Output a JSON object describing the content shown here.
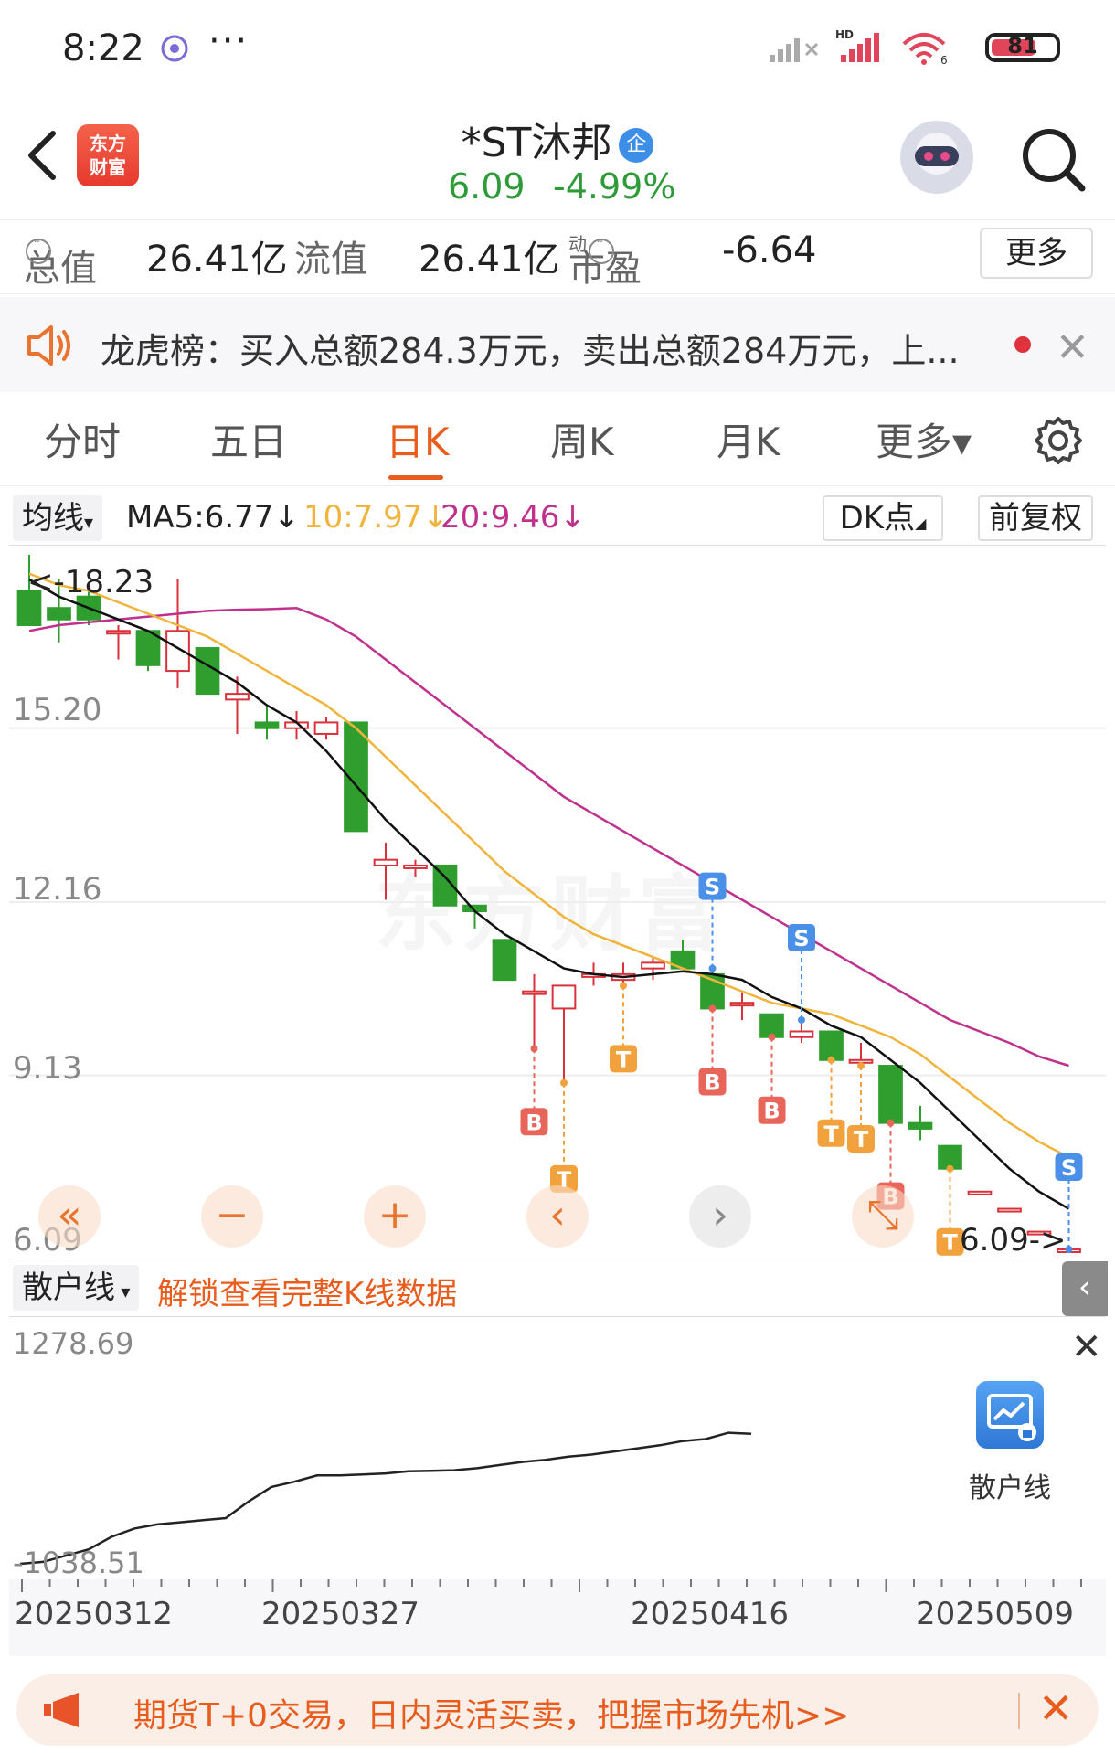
{
  "status_bar": {
    "time": "8:22",
    "dots": "···",
    "battery": "81"
  },
  "header": {
    "logo_line1": "东方",
    "logo_line2": "财富",
    "stock_name": "*ST沐邦",
    "stock_tag": "企",
    "price": "6.09",
    "change": "-4.99%"
  },
  "metrics": {
    "total_value_label": "总值",
    "total_value": "26.41亿",
    "float_value_label": "流值",
    "float_value": "26.41亿",
    "pe_label": "市盈",
    "pe_super": "动",
    "pe_value": "-6.64",
    "more_button": "更多"
  },
  "alert": {
    "text": "龙虎榜：买入总额284.3万元，卖出总额284万元，上..."
  },
  "tabs": [
    {
      "label": "分时"
    },
    {
      "label": "五日"
    },
    {
      "label": "日K"
    },
    {
      "label": "周K"
    },
    {
      "label": "月K"
    },
    {
      "label": "更多▾"
    }
  ],
  "active_tab": "日K",
  "ma_bar": {
    "selector": "均线",
    "ma5": "MA5:6.77",
    "ma10": "10:7.97",
    "ma20": "20:9.46",
    "dk_button": "DK点",
    "fq_button": "前复权"
  },
  "kchart": {
    "watermark": "东方财富",
    "y_labels": [
      "15.20",
      "12.16",
      "9.13",
      "6.09"
    ],
    "high_label": "<-18.23",
    "low_label": "6.09->",
    "colors": {
      "up": "#d8323c",
      "down": "#2f9e2f",
      "ma5": "#111111",
      "ma10": "#f0b33c",
      "ma20": "#c0318d"
    }
  },
  "chart_data": {
    "type": "candlestick",
    "price_range": [
      6.09,
      18.23
    ],
    "candles": [
      {
        "o": 17.6,
        "h": 18.23,
        "l": 17.0,
        "c": 17.0
      },
      {
        "o": 17.3,
        "h": 17.8,
        "l": 16.7,
        "c": 17.1
      },
      {
        "o": 17.5,
        "h": 17.7,
        "l": 17.0,
        "c": 17.1
      },
      {
        "o": 16.9,
        "h": 17.0,
        "l": 16.4,
        "c": 16.9
      },
      {
        "o": 16.9,
        "h": 16.9,
        "l": 16.2,
        "c": 16.3
      },
      {
        "o": 16.2,
        "h": 17.8,
        "l": 15.9,
        "c": 16.9
      },
      {
        "o": 16.6,
        "h": 16.6,
        "l": 15.8,
        "c": 15.8
      },
      {
        "o": 15.7,
        "h": 16.1,
        "l": 15.1,
        "c": 15.8
      },
      {
        "o": 15.3,
        "h": 15.6,
        "l": 15.0,
        "c": 15.2
      },
      {
        "o": 15.2,
        "h": 15.5,
        "l": 15.0,
        "c": 15.3
      },
      {
        "o": 15.1,
        "h": 15.4,
        "l": 15.0,
        "c": 15.3
      },
      {
        "o": 15.3,
        "h": 15.3,
        "l": 13.4,
        "c": 13.4
      },
      {
        "o": 12.8,
        "h": 13.2,
        "l": 12.2,
        "c": 12.9
      },
      {
        "o": 12.8,
        "h": 12.9,
        "l": 12.6,
        "c": 12.8
      },
      {
        "o": 12.8,
        "h": 12.8,
        "l": 12.1,
        "c": 12.1
      },
      {
        "o": 12.1,
        "h": 12.1,
        "l": 11.7,
        "c": 12.0
      },
      {
        "o": 11.5,
        "h": 11.5,
        "l": 10.8,
        "c": 10.8
      },
      {
        "o": 10.6,
        "h": 10.9,
        "l": 9.6,
        "c": 10.6
      },
      {
        "o": 10.3,
        "h": 10.7,
        "l": 9.0,
        "c": 10.7
      },
      {
        "o": 10.9,
        "h": 11.1,
        "l": 10.7,
        "c": 10.9
      },
      {
        "o": 10.8,
        "h": 11.1,
        "l": 10.7,
        "c": 10.9
      },
      {
        "o": 11.0,
        "h": 11.2,
        "l": 10.8,
        "c": 11.1
      },
      {
        "o": 11.3,
        "h": 11.5,
        "l": 11.0,
        "c": 11.0
      },
      {
        "o": 10.9,
        "h": 11.0,
        "l": 10.3,
        "c": 10.3
      },
      {
        "o": 10.4,
        "h": 10.6,
        "l": 10.1,
        "c": 10.4
      },
      {
        "o": 10.2,
        "h": 10.2,
        "l": 9.8,
        "c": 9.8
      },
      {
        "o": 9.8,
        "h": 10.1,
        "l": 9.7,
        "c": 9.9
      },
      {
        "o": 9.9,
        "h": 9.9,
        "l": 9.4,
        "c": 9.4
      },
      {
        "o": 9.4,
        "h": 9.7,
        "l": 9.3,
        "c": 9.4
      },
      {
        "o": 9.3,
        "h": 9.3,
        "l": 8.3,
        "c": 8.3
      },
      {
        "o": 8.3,
        "h": 8.6,
        "l": 8.0,
        "c": 8.2
      },
      {
        "o": 7.9,
        "h": 7.9,
        "l": 7.5,
        "c": 7.5
      },
      {
        "o": 7.1,
        "h": 7.1,
        "l": 7.1,
        "c": 7.1
      },
      {
        "o": 6.8,
        "h": 6.8,
        "l": 6.8,
        "c": 6.8
      },
      {
        "o": 6.4,
        "h": 6.4,
        "l": 6.4,
        "c": 6.4
      },
      {
        "o": 6.09,
        "h": 6.09,
        "l": 6.09,
        "c": 6.09
      }
    ],
    "ma5": [
      17.8,
      17.5,
      17.3,
      17.1,
      16.9,
      16.6,
      16.3,
      16.0,
      15.6,
      15.3,
      14.8,
      14.2,
      13.6,
      13.1,
      12.6,
      12.0,
      11.6,
      11.3,
      11.0,
      10.9,
      10.85,
      10.9,
      10.95,
      10.9,
      10.8,
      10.5,
      10.3,
      10.0,
      9.8,
      9.4,
      9.0,
      8.5,
      8.0,
      7.5,
      7.1,
      6.8
    ],
    "ma10": [
      17.9,
      17.7,
      17.6,
      17.4,
      17.2,
      17.0,
      16.8,
      16.5,
      16.2,
      15.9,
      15.6,
      15.2,
      14.7,
      14.2,
      13.7,
      13.2,
      12.7,
      12.3,
      11.9,
      11.6,
      11.4,
      11.2,
      11.0,
      10.8,
      10.6,
      10.4,
      10.3,
      10.2,
      10.0,
      9.8,
      9.5,
      9.1,
      8.7,
      8.3,
      7.97,
      7.7
    ],
    "ma20": [
      16.9,
      17.0,
      17.05,
      17.1,
      17.15,
      17.2,
      17.25,
      17.27,
      17.28,
      17.3,
      17.1,
      16.8,
      16.4,
      16.0,
      15.6,
      15.2,
      14.8,
      14.4,
      14.0,
      13.7,
      13.4,
      13.1,
      12.8,
      12.5,
      12.2,
      11.9,
      11.6,
      11.3,
      11.0,
      10.7,
      10.4,
      10.1,
      9.9,
      9.7,
      9.46,
      9.3
    ],
    "signals": [
      {
        "i": 17,
        "type": "B"
      },
      {
        "i": 18,
        "type": "T"
      },
      {
        "i": 20,
        "type": "T"
      },
      {
        "i": 23,
        "type": "S"
      },
      {
        "i": 23,
        "type": "B"
      },
      {
        "i": 25,
        "type": "B"
      },
      {
        "i": 26,
        "type": "S"
      },
      {
        "i": 27,
        "type": "T"
      },
      {
        "i": 28,
        "type": "T"
      },
      {
        "i": 29,
        "type": "B"
      },
      {
        "i": 31,
        "type": "T"
      },
      {
        "i": 35,
        "type": "S"
      }
    ]
  },
  "controls": {
    "first": "«",
    "zoom_out": "−",
    "zoom_in": "+",
    "prev": "‹",
    "next": "›",
    "fullscreen": "⤡"
  },
  "sub_indicator": {
    "selector": "散户线",
    "unlock_text": "解锁查看完整K线数据",
    "y_max": "1278.69",
    "y_min": "-1038.51",
    "promo_label": "散户线",
    "values": [
      -1038.51,
      -1020,
      -960,
      -900,
      -780,
      -700,
      -660,
      -640,
      -620,
      -600,
      -440,
      -300,
      -250,
      -190,
      -190,
      -180,
      -170,
      -150,
      -145,
      -140,
      -120,
      -90,
      -60,
      -40,
      -10,
      10,
      40,
      70,
      100,
      140,
      160,
      220,
      210
    ]
  },
  "x_axis": {
    "labels": [
      "20250312",
      "20250327",
      "20250416",
      "20250509"
    ]
  },
  "promo": {
    "text": "期货T+0交易，日内灵活买卖，把握市场先机>>"
  }
}
